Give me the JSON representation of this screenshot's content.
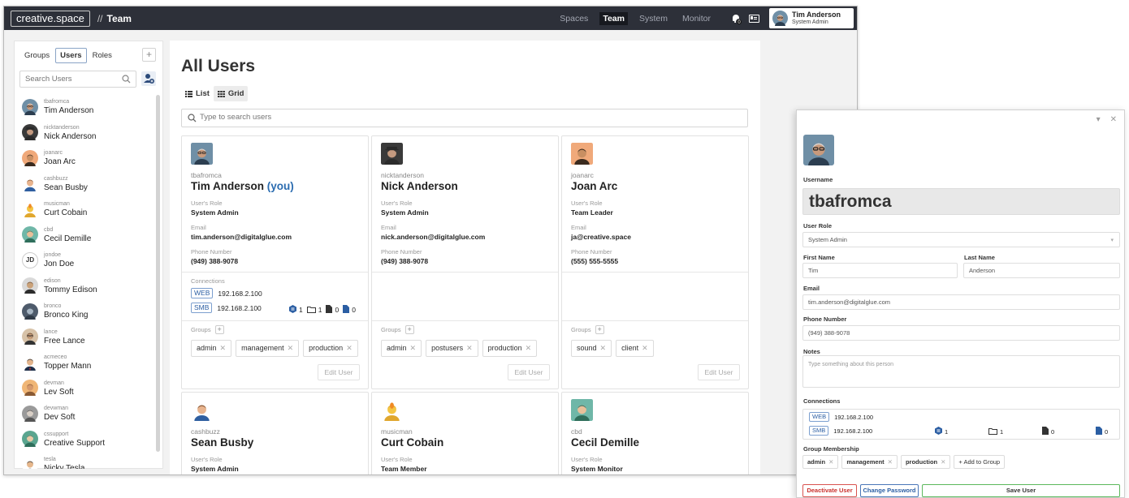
{
  "app": {
    "brand": "creative.space",
    "crumb_sep": "//",
    "crumb": "Team",
    "nav": [
      "Spaces",
      "Team",
      "System",
      "Monitor"
    ],
    "nav_active": "Team",
    "notification_count": "0",
    "current_user": {
      "name": "Tim Anderson",
      "role": "System Admin"
    }
  },
  "sidebar": {
    "tabs": [
      "Groups",
      "Users",
      "Roles"
    ],
    "active_tab": "Users",
    "add_label": "+",
    "search_placeholder": "Search Users",
    "users": [
      {
        "username": "tbafromca",
        "name": "Tim Anderson",
        "avatar": "tim"
      },
      {
        "username": "nicktanderson",
        "name": "Nick Anderson",
        "avatar": "nick"
      },
      {
        "username": "joanarc",
        "name": "Joan Arc",
        "avatar": "joan"
      },
      {
        "username": "cashbuzz",
        "name": "Sean Busby",
        "avatar": "sean"
      },
      {
        "username": "musicman",
        "name": "Curt Cobain",
        "avatar": "curt"
      },
      {
        "username": "cbd",
        "name": "Cecil Demille",
        "avatar": "cecil"
      },
      {
        "username": "jondoe",
        "name": "Jon Doe",
        "avatar": "initials",
        "initials": "JD"
      },
      {
        "username": "edison",
        "name": "Tommy Edison",
        "avatar": "tommy"
      },
      {
        "username": "bronco",
        "name": "Bronco King",
        "avatar": "bronco"
      },
      {
        "username": "lance",
        "name": "Free Lance",
        "avatar": "lance"
      },
      {
        "username": "acmeceo",
        "name": "Topper Mann",
        "avatar": "topper"
      },
      {
        "username": "devman",
        "name": "Lev Soft",
        "avatar": "lev"
      },
      {
        "username": "devwman",
        "name": "Dev Soft",
        "avatar": "dev"
      },
      {
        "username": "cssupport",
        "name": "Creative Support",
        "avatar": "support"
      },
      {
        "username": "tesla",
        "name": "Nicky Tesla",
        "avatar": "tesla"
      }
    ]
  },
  "main": {
    "title": "All Users",
    "views": [
      "List",
      "Grid"
    ],
    "active_view": "Grid",
    "search_placeholder": "Type to search users",
    "labels": {
      "role": "User's Role",
      "email": "Email",
      "phone": "Phone Number",
      "connections": "Connections",
      "groups": "Groups",
      "edit": "Edit User",
      "you": "(you)"
    },
    "cards": [
      {
        "username": "tbafromca",
        "name": "Tim Anderson",
        "is_you": true,
        "avatar": "tim",
        "role": "System Admin",
        "email": "tim.anderson@digitalglue.com",
        "phone": "(949) 388-9078",
        "connections": [
          {
            "type": "WEB",
            "ip": "192.168.2.100"
          },
          {
            "type": "SMB",
            "ip": "192.168.2.100"
          }
        ],
        "stats": {
          "volumes": "1",
          "folders": "1",
          "files": "0",
          "docs": "0"
        },
        "groups": [
          "admin",
          "management",
          "production"
        ]
      },
      {
        "username": "nicktanderson",
        "name": "Nick Anderson",
        "is_you": false,
        "avatar": "nick",
        "role": "System Admin",
        "email": "nick.anderson@digitalglue.com",
        "phone": "(949) 388-9078",
        "connections": [],
        "stats": null,
        "groups": [
          "admin",
          "postusers",
          "production"
        ]
      },
      {
        "username": "joanarc",
        "name": "Joan Arc",
        "is_you": false,
        "avatar": "joan",
        "role": "Team Leader",
        "email": "ja@creative.space",
        "phone": "(555) 555-5555",
        "connections": [],
        "stats": null,
        "groups": [
          "sound",
          "client"
        ]
      },
      {
        "username": "cashbuzz",
        "name": "Sean Busby",
        "is_you": false,
        "avatar": "sean",
        "role": "System Admin",
        "email": "",
        "phone": "",
        "connections": [],
        "stats": null,
        "groups": []
      },
      {
        "username": "musicman",
        "name": "Curt Cobain",
        "is_you": false,
        "avatar": "curt",
        "role": "Team Member",
        "email": "",
        "phone": "",
        "connections": [],
        "stats": null,
        "groups": []
      },
      {
        "username": "cbd",
        "name": "Cecil Demille",
        "is_you": false,
        "avatar": "cecil",
        "role": "System Monitor",
        "email": "",
        "phone": "",
        "connections": [],
        "stats": null,
        "groups": []
      }
    ]
  },
  "panel": {
    "labels": {
      "username": "Username",
      "role": "User Role",
      "first": "First Name",
      "last": "Last Name",
      "email": "Email",
      "phone": "Phone Number",
      "notes": "Notes",
      "connections": "Connections",
      "groups": "Group Membership"
    },
    "username": "tbafromca",
    "role": "System Admin",
    "first_name": "Tim",
    "last_name": "Anderson",
    "email": "tim.anderson@digitalglue.com",
    "phone": "(949) 388-9078",
    "notes_placeholder": "Type something about this person",
    "connections": [
      {
        "type": "WEB",
        "ip": "192.168.2.100"
      },
      {
        "type": "SMB",
        "ip": "192.168.2.100"
      }
    ],
    "stats": {
      "volumes": "1",
      "folders": "1",
      "files": "0",
      "docs": "0"
    },
    "groups": [
      "admin",
      "management",
      "production"
    ],
    "add_group_label": "+ Add to Group",
    "buttons": {
      "deactivate": "Deactivate User",
      "password": "Change Password",
      "save": "Save User"
    }
  },
  "colors": {
    "topbar": "#2d3039",
    "accent": "#2b6cb0",
    "danger": "#d9534f",
    "success": "#5cb85c"
  }
}
